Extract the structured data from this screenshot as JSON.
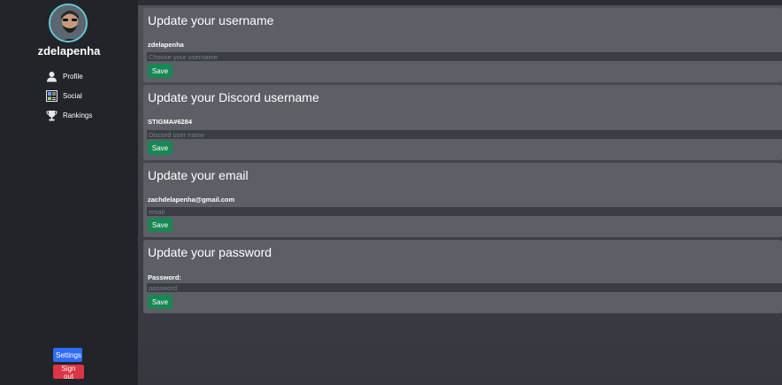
{
  "sidebar": {
    "username": "zdelapenha",
    "nav": [
      {
        "label": "Profile",
        "icon": "user-icon"
      },
      {
        "label": "Social",
        "icon": "social-icon"
      },
      {
        "label": "Rankings",
        "icon": "trophy-icon"
      }
    ],
    "settings_label": "Settings",
    "signout_label": "Sign out"
  },
  "cards": [
    {
      "title": "Update your username",
      "current": "zdelapenha",
      "placeholder": "Choose your username",
      "save_label": "Save"
    },
    {
      "title": "Update your Discord username",
      "current": "STIGMA#6284",
      "placeholder": "Discord user name",
      "save_label": "Save"
    },
    {
      "title": "Update your email",
      "current": "zachdelapenha@gmail.com",
      "placeholder": "email",
      "save_label": "Save"
    },
    {
      "title": "Update your password",
      "current": "Password:",
      "placeholder": "password",
      "save_label": "Save"
    }
  ],
  "colors": {
    "sidebar_bg": "#212429",
    "card_bg": "#5c5f66",
    "save_green": "#198754",
    "settings_blue": "#2f6cf5",
    "signout_red": "#dc3545"
  }
}
